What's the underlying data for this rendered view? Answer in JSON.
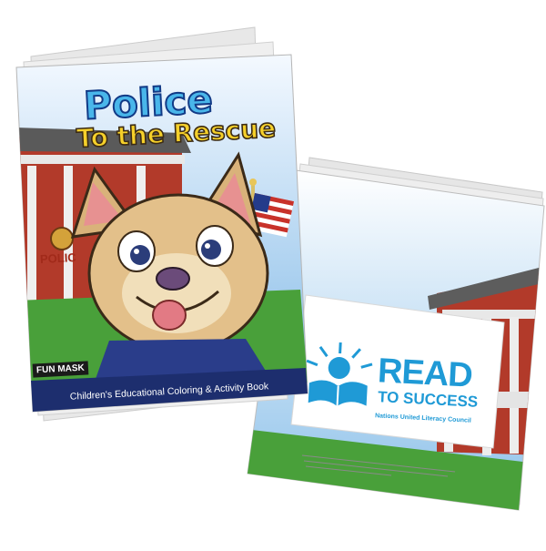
{
  "front_cover": {
    "title_line1": "Police",
    "title_line2": "To the Rescue",
    "building_sign": "POLIC",
    "brand": "FUN MASK",
    "subtitle": "Children's Educational Coloring & Activity Book"
  },
  "back_cover": {
    "logo_title": "READ",
    "logo_subtitle": "TO SUCCESS",
    "organization": "Nations United Literacy Council"
  },
  "colors": {
    "sky_top": "#ffffff",
    "sky_bottom": "#7fb8e6",
    "grass": "#49a03a",
    "footer_band": "#1d2e6e",
    "brick": "#b23a2a",
    "read_blue": "#1f9ad6",
    "title_blue": "#49b6ea",
    "title_yellow": "#f5d02a"
  }
}
